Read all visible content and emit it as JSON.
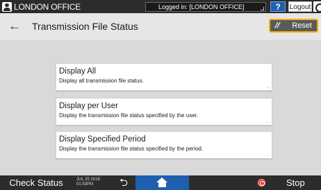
{
  "topbar": {
    "office": "LONDON OFFICE",
    "logged_in": "Logged in: [LONDON OFFICE]",
    "help": "?",
    "logout": "Logout"
  },
  "header": {
    "title": "Transmission File Status",
    "reset": "Reset"
  },
  "options": [
    {
      "title": "Display All",
      "desc": "Display all transmission file status.",
      "more": "..."
    },
    {
      "title": "Display per User",
      "desc": "Display the transmission file status specified by the user.",
      "more": "..."
    },
    {
      "title": "Display Specified Period",
      "desc": "Display the transmission file status specified by the period.",
      "more": "..."
    }
  ],
  "bottombar": {
    "check_status": "Check Status",
    "date": "JUL 25 2018",
    "time": "01:53PM",
    "stop": "Stop"
  },
  "colors": {
    "accent_blue": "#1f5fb0",
    "reset_border": "#f0b400",
    "stop_red": "#e2412a",
    "bar_dark": "#2c2c2c"
  }
}
